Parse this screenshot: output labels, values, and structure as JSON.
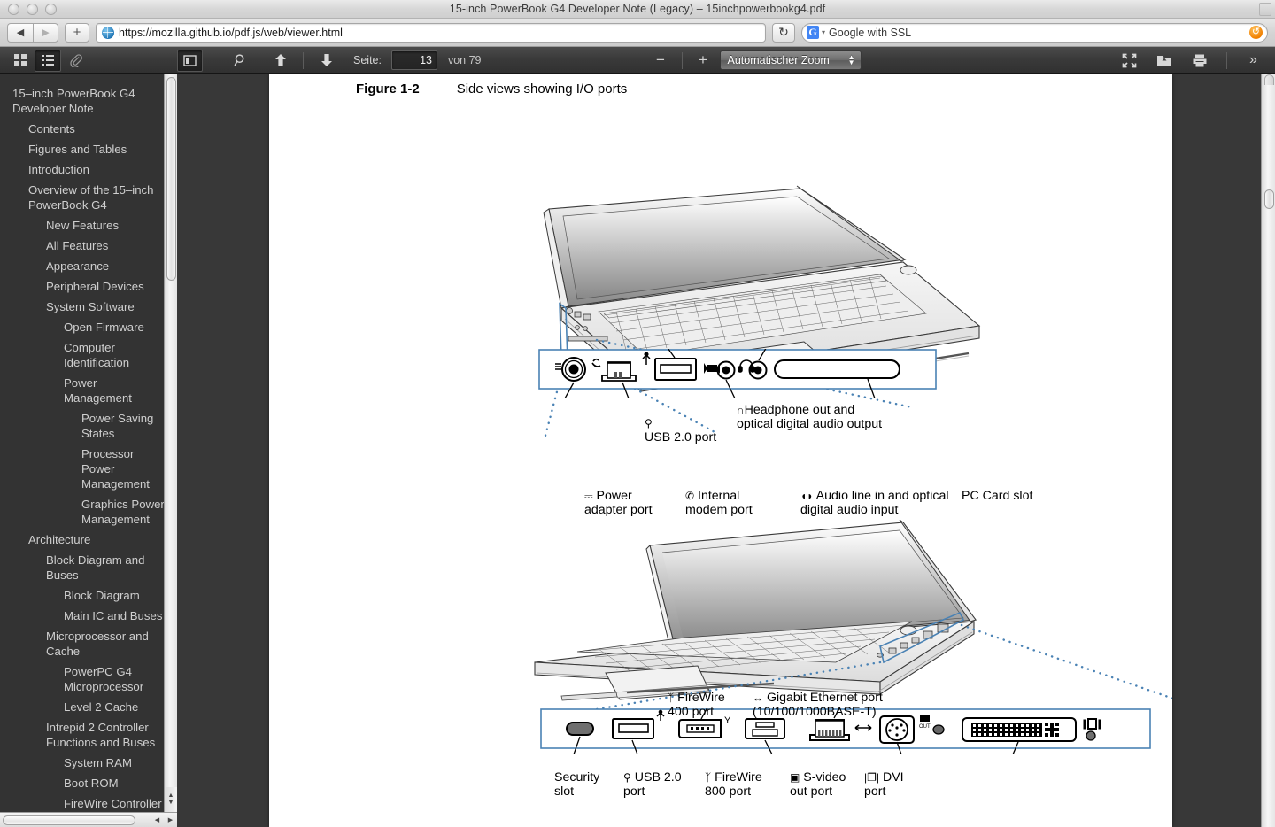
{
  "window": {
    "title": "15-inch PowerBook G4 Developer Note (Legacy) – 15inchpowerbookg4.pdf"
  },
  "nav": {
    "back_icon": "◀",
    "forward_icon": "▶",
    "newtab_icon": "+",
    "url": "https://mozilla.github.io/pdf.js/web/viewer.html",
    "reload_icon": "↻",
    "search_engine": "G",
    "search_placeholder": "Google with SSL",
    "search_value": "Google with SSL",
    "reader_icon": "↺"
  },
  "toolbar": {
    "thumbnails_icon": "▦",
    "outline_icon": "☰",
    "attachments_icon": "📎",
    "sidebar_toggle_icon": "◫",
    "find_icon": "🔍",
    "prev_page_icon": "↑",
    "next_page_icon": "↓",
    "page_label": "Seite:",
    "page_number": "13",
    "page_total": "von 79",
    "zoom_out_icon": "−",
    "zoom_in_icon": "+",
    "zoom_value": "Automatischer Zoom",
    "presentation_icon": "⤢",
    "open_file_icon": "⬆",
    "print_icon": "🖨",
    "more_tools_icon": "»"
  },
  "sidebar": {
    "items": [
      {
        "label": "15–inch PowerBook G4 Developer Note",
        "level": 0
      },
      {
        "label": "Contents",
        "level": 1
      },
      {
        "label": "Figures and Tables",
        "level": 1
      },
      {
        "label": "Introduction",
        "level": 1
      },
      {
        "label": "Overview of the 15–inch PowerBook G4",
        "level": 1
      },
      {
        "label": "New Features",
        "level": 2
      },
      {
        "label": "All Features",
        "level": 2
      },
      {
        "label": "Appearance",
        "level": 2
      },
      {
        "label": "Peripheral Devices",
        "level": 2
      },
      {
        "label": "System Software",
        "level": 2
      },
      {
        "label": "Open Firmware",
        "level": 3
      },
      {
        "label": "Computer Identification",
        "level": 3
      },
      {
        "label": "Power Management",
        "level": 3
      },
      {
        "label": "Power Saving States",
        "level": 4
      },
      {
        "label": "Processor Power Management",
        "level": 4
      },
      {
        "label": "Graphics Power Management",
        "level": 4
      },
      {
        "label": "Architecture",
        "level": 1
      },
      {
        "label": "Block Diagram and Buses",
        "level": 2
      },
      {
        "label": "Block Diagram",
        "level": 3
      },
      {
        "label": "Main IC and Buses",
        "level": 3
      },
      {
        "label": "Microprocessor and Cache",
        "level": 2
      },
      {
        "label": "PowerPC G4 Microprocessor",
        "level": 3
      },
      {
        "label": "Level 2 Cache",
        "level": 3
      },
      {
        "label": "Intrepid 2 Controller Functions and Buses",
        "level": 2
      },
      {
        "label": "System RAM",
        "level": 3
      },
      {
        "label": "Boot ROM",
        "level": 3
      },
      {
        "label": "FireWire Controller",
        "level": 3
      }
    ]
  },
  "document": {
    "figure": {
      "number": "Figure 1-2",
      "title": "Side views showing I/O ports"
    },
    "figure_left": {
      "labels": [
        {
          "icon": "usb-icon",
          "text": "USB 2.0 port"
        },
        {
          "icon": "headphone-icon",
          "text": "Headphone out and\noptical digital audio output"
        },
        {
          "icon": "power-icon",
          "text": "Power\nadapter port"
        },
        {
          "icon": "modem-icon",
          "text": "Internal\nmodem port"
        },
        {
          "icon": "audio-in-icon",
          "text": "Audio line in and optical\ndigital audio input"
        },
        {
          "icon": "",
          "text": "PC Card slot"
        }
      ]
    },
    "figure_right": {
      "labels": [
        {
          "icon": "firewire-icon",
          "text": "FireWire\n400 port"
        },
        {
          "icon": "ethernet-icon",
          "text": "Gigabit Ethernet port\n(10/100/1000BASE-T)"
        },
        {
          "icon": "",
          "text": "Security\nslot"
        },
        {
          "icon": "usb-icon",
          "text": "USB 2.0\nport"
        },
        {
          "icon": "firewire-icon",
          "text": "FireWire\n800 port"
        },
        {
          "icon": "svideo-icon",
          "text": "S-video\nout port"
        },
        {
          "icon": "dvi-icon",
          "text": "DVI\nport"
        }
      ]
    }
  },
  "colors": {
    "toolbar_bg": "#3a3a3a",
    "sidebar_bg": "#333333",
    "viewer_bg": "#383838",
    "page_bg": "#ffffff",
    "callout_blue": "#3f7cb0",
    "accent_orange": "#f08000"
  }
}
